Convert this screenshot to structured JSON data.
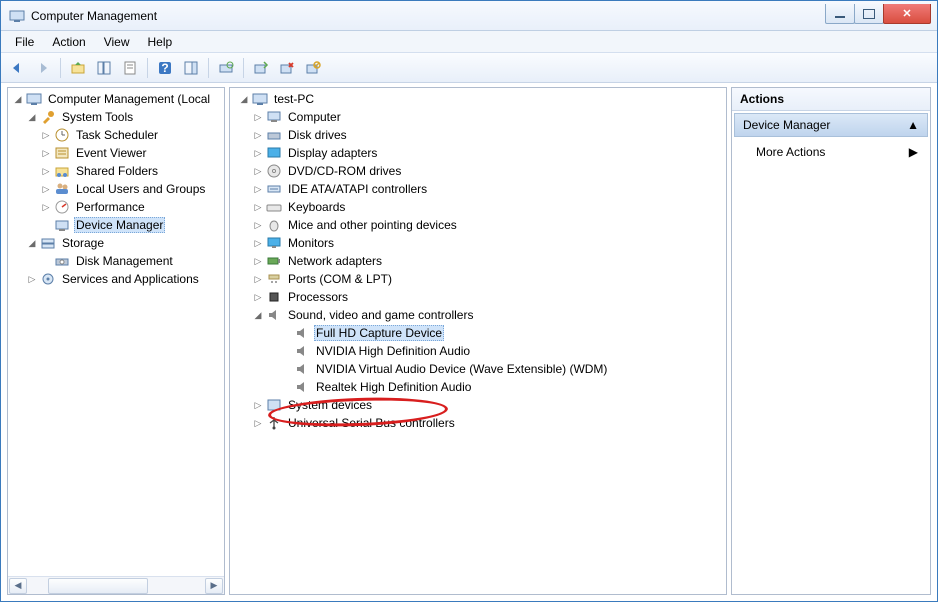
{
  "window": {
    "title": "Computer Management"
  },
  "menu": {
    "file": "File",
    "action": "Action",
    "view": "View",
    "help": "Help"
  },
  "left_tree": {
    "root": "Computer Management (Local",
    "system_tools": "System Tools",
    "task_scheduler": "Task Scheduler",
    "event_viewer": "Event Viewer",
    "shared_folders": "Shared Folders",
    "local_users": "Local Users and Groups",
    "performance": "Performance",
    "device_manager": "Device Manager",
    "storage": "Storage",
    "disk_management": "Disk Management",
    "services_apps": "Services and Applications"
  },
  "mid_tree": {
    "root": "test-PC",
    "computer": "Computer",
    "disk_drives": "Disk drives",
    "display_adapters": "Display adapters",
    "dvd": "DVD/CD-ROM drives",
    "ide": "IDE ATA/ATAPI controllers",
    "keyboards": "Keyboards",
    "mice": "Mice and other pointing devices",
    "monitors": "Monitors",
    "network": "Network adapters",
    "ports": "Ports (COM & LPT)",
    "processors": "Processors",
    "sound": "Sound, video and game controllers",
    "sound_full_hd": "Full HD Capture Device",
    "sound_nvidia_hd": "NVIDIA High Definition Audio",
    "sound_nvidia_virtual": "NVIDIA Virtual Audio Device (Wave Extensible) (WDM)",
    "sound_realtek": "Realtek High Definition Audio",
    "system_devices": "System devices",
    "usb": "Universal Serial Bus controllers"
  },
  "actions": {
    "header": "Actions",
    "section": "Device Manager",
    "more": "More Actions"
  }
}
